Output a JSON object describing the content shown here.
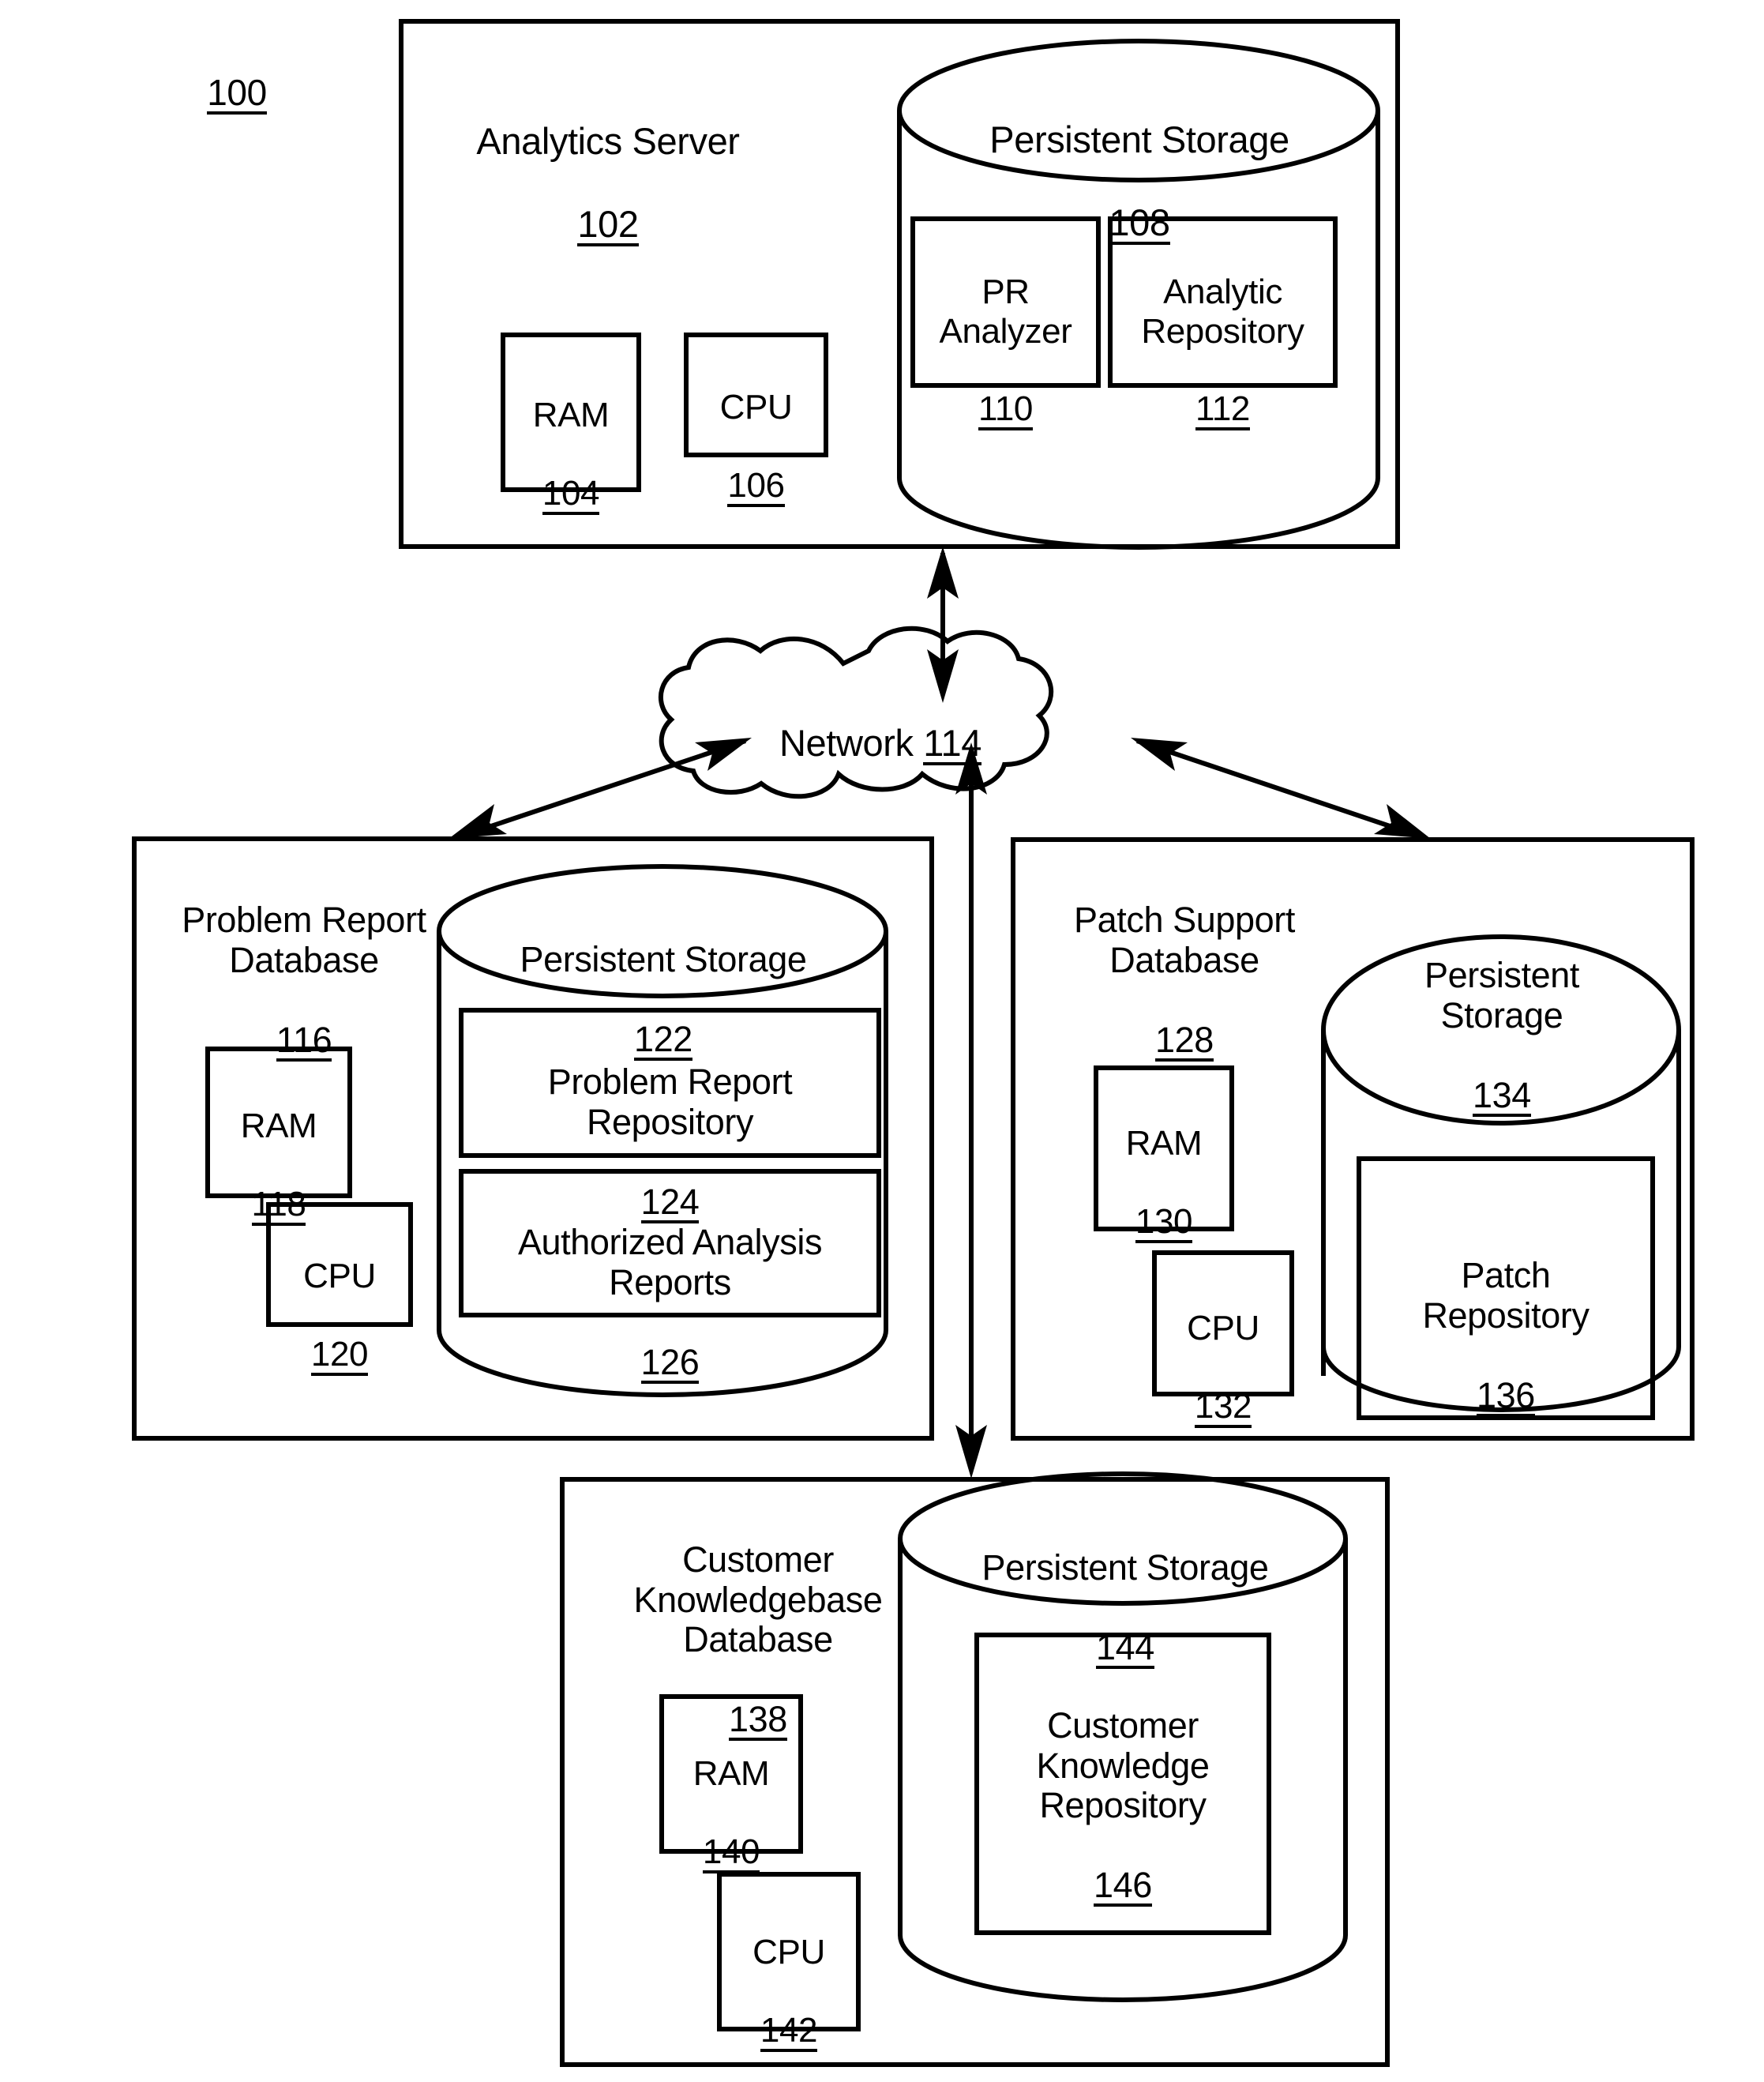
{
  "figure": {
    "reference_numeral": "100"
  },
  "analytics_server": {
    "title": "Analytics Server",
    "numeral": "102",
    "ram": {
      "label": "RAM",
      "numeral": "104"
    },
    "cpu": {
      "label": "CPU",
      "numeral": "106"
    },
    "storage": {
      "title": "Persistent Storage",
      "numeral": "108",
      "components": [
        {
          "label": "PR\nAnalyzer",
          "numeral": "110"
        },
        {
          "label": "Analytic\nRepository",
          "numeral": "112"
        }
      ]
    }
  },
  "network": {
    "label": "Network",
    "numeral": "114"
  },
  "problem_report_db": {
    "title": "Problem Report\nDatabase",
    "numeral": "116",
    "ram": {
      "label": "RAM",
      "numeral": "118"
    },
    "cpu": {
      "label": "CPU",
      "numeral": "120"
    },
    "storage": {
      "title": "Persistent Storage",
      "numeral": "122",
      "components": [
        {
          "label": "Problem Report\nRepository",
          "numeral": "124"
        },
        {
          "label": "Authorized Analysis\nReports",
          "numeral": "126"
        }
      ]
    }
  },
  "patch_support_db": {
    "title": "Patch Support\nDatabase",
    "numeral": "128",
    "ram": {
      "label": "RAM",
      "numeral": "130"
    },
    "cpu": {
      "label": "CPU",
      "numeral": "132"
    },
    "storage": {
      "title": "Persistent\nStorage",
      "numeral": "134",
      "components": [
        {
          "label": "Patch\nRepository",
          "numeral": "136"
        }
      ]
    }
  },
  "customer_kb_db": {
    "title": "Customer\nKnowledgebase\nDatabase",
    "numeral": "138",
    "ram": {
      "label": "RAM",
      "numeral": "140"
    },
    "cpu": {
      "label": "CPU",
      "numeral": "142"
    },
    "storage": {
      "title": "Persistent Storage",
      "numeral": "144",
      "components": [
        {
          "label": "Customer\nKnowledge\nRepository",
          "numeral": "146"
        }
      ]
    }
  },
  "style": {
    "stroke": "#000000",
    "background": "#ffffff"
  }
}
